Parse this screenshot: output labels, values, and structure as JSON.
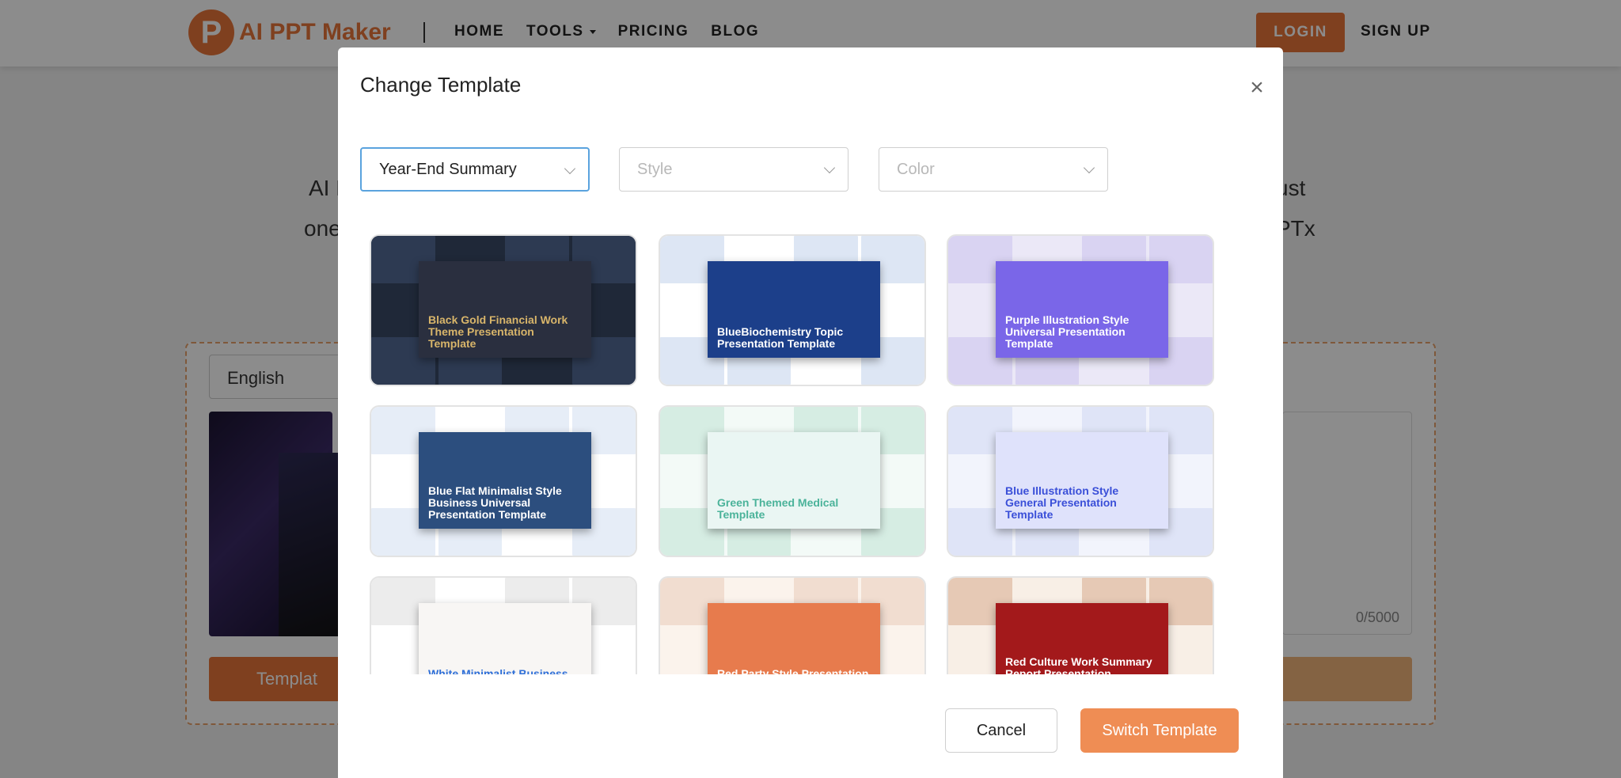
{
  "nav": {
    "logo_letter": "P",
    "logo_text": "AI PPT Maker",
    "links": [
      {
        "label": "HOME",
        "has_caret": false
      },
      {
        "label": "TOOLS",
        "has_caret": true
      },
      {
        "label": "PRICING",
        "has_caret": false
      },
      {
        "label": "BLOG",
        "has_caret": false
      }
    ],
    "login": "LOGIN",
    "signup": "SIGN UP"
  },
  "background": {
    "line1_left": "AI P",
    "line1_right": "ust",
    "line2_left": "one",
    "line2_right": "PTx",
    "language": "English",
    "char_count": "0/5000",
    "template_button": "Templat"
  },
  "modal": {
    "title": "Change Template",
    "filters": {
      "category": {
        "value": "Year-End Summary"
      },
      "style": {
        "placeholder": "Style"
      },
      "color": {
        "placeholder": "Color"
      }
    },
    "templates": [
      {
        "title": "Black Gold Financial Work Theme Presentation Template",
        "bg": "#1f2838",
        "tile": "#2d3a52",
        "hero": "#2a2f3f",
        "text": "#d8b56a"
      },
      {
        "title": "BlueBiochemistry Topic Presentation Template",
        "bg": "#ffffff",
        "tile": "#dde6f4",
        "hero": "#1c3f8a",
        "text": "#ffffff"
      },
      {
        "title": "Purple Illustration Style Universal Presentation Template",
        "bg": "#ebe8f7",
        "tile": "#d9d3f2",
        "hero": "#7a66e8",
        "text": "#ffffff"
      },
      {
        "title": "Blue Flat Minimalist Style Business Universal Presentation Template",
        "bg": "#ffffff",
        "tile": "#e6edf7",
        "hero": "#2c4e7e",
        "text": "#ffffff"
      },
      {
        "title": "Green Themed Medical Template",
        "bg": "#f3faf7",
        "tile": "#d6ede3",
        "hero": "#eaf6f3",
        "text": "#4bb39a"
      },
      {
        "title": "Blue Illustration Style General Presentation Template",
        "bg": "#f2f4fc",
        "tile": "#dfe4f7",
        "hero": "#dfe2fb",
        "text": "#3a4fd8"
      },
      {
        "title": "White Minimalist Business Presentation Template",
        "bg": "#ffffff",
        "tile": "#ececec",
        "hero": "#f8f6f4",
        "text": "#2e6fd8"
      },
      {
        "title": "Red Party Style Presentation Template",
        "bg": "#fbf3ec",
        "tile": "#f1ddd0",
        "hero": "#e77b4d",
        "text": "#ffffff"
      },
      {
        "title": "Red Culture Work Summary Report Presentation Template",
        "bg": "#f8efe6",
        "tile": "#e6c9b5",
        "hero": "#a3191b",
        "text": "#ffffff"
      }
    ],
    "cancel_label": "Cancel",
    "switch_label": "Switch Template"
  }
}
